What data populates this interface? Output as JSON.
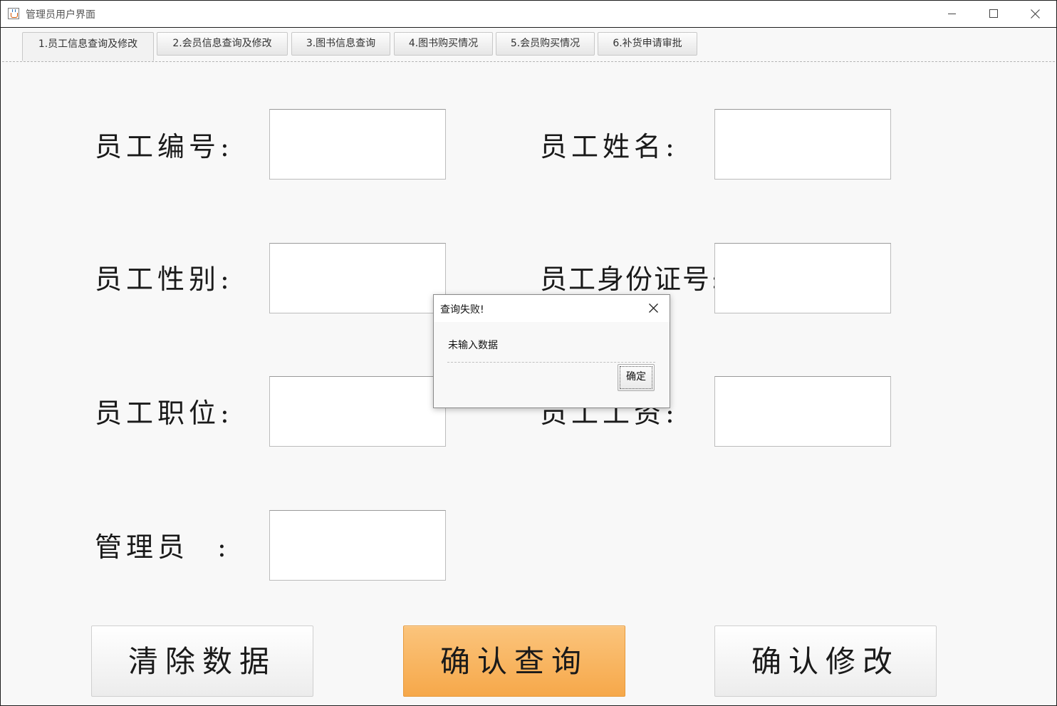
{
  "window": {
    "title": "管理员用户界面",
    "controls": [
      "minimize",
      "maximize",
      "close"
    ]
  },
  "tabs": [
    {
      "label": "1.员工信息查询及修改",
      "active": true
    },
    {
      "label": "2.会员信息查询及修改",
      "active": false
    },
    {
      "label": "3.图书信息查询",
      "active": false
    },
    {
      "label": "4.图书购买情况",
      "active": false
    },
    {
      "label": "5.会员购买情况",
      "active": false
    },
    {
      "label": "6.补货申请审批",
      "active": false
    }
  ],
  "form": {
    "employee_id": {
      "label": "员工编号:",
      "value": ""
    },
    "employee_name": {
      "label": "员工姓名:",
      "value": ""
    },
    "employee_gender": {
      "label": "员工性别:",
      "value": ""
    },
    "employee_idcard": {
      "label": "员工身份证号:",
      "value": ""
    },
    "employee_position": {
      "label": "员工职位:",
      "value": ""
    },
    "employee_salary": {
      "label": "员工工资:",
      "value": ""
    },
    "admin": {
      "label": "管理员",
      "colon": ":",
      "value": ""
    }
  },
  "buttons": {
    "clear": "清除数据",
    "query": "确认查询",
    "modify": "确认修改"
  },
  "dialog": {
    "title": "查询失败!",
    "message": "未输入数据",
    "ok": "确定"
  },
  "colors": {
    "primary_button": "#f6a84a",
    "background": "#f8f8f8"
  }
}
